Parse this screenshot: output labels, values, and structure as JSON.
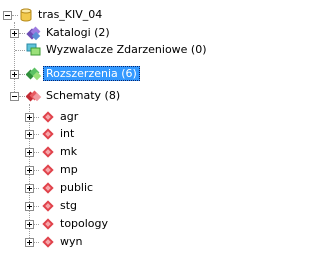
{
  "tree": {
    "root": {
      "label": "tras_KIV_04",
      "icon": "database-icon",
      "expanded": true
    },
    "children": [
      {
        "label": "Katalogi (2)",
        "icon": "catalog-icon",
        "expanded": false,
        "selected": false
      },
      {
        "label": "Wyzwalacze Zdarzeniowe (0)",
        "icon": "event-trigger-icon",
        "expanded": null,
        "selected": false
      },
      {
        "label": "Rozszerzenia (6)",
        "icon": "extension-icon",
        "expanded": false,
        "selected": true
      },
      {
        "label": "Schematy (8)",
        "icon": "schemas-icon",
        "expanded": true,
        "selected": false
      }
    ],
    "schemas": [
      {
        "label": "agr",
        "icon": "schema-icon"
      },
      {
        "label": "int",
        "icon": "schema-icon"
      },
      {
        "label": "mk",
        "icon": "schema-icon"
      },
      {
        "label": "mp",
        "icon": "schema-icon"
      },
      {
        "label": "public",
        "icon": "schema-icon"
      },
      {
        "label": "stg",
        "icon": "schema-icon"
      },
      {
        "label": "topology",
        "icon": "schema-icon"
      },
      {
        "label": "wyn",
        "icon": "schema-icon"
      }
    ]
  },
  "colors": {
    "selection_background": "#3399ff",
    "selection_text": "#ffffff",
    "database_icon": "#f2c94c",
    "catalog_icon": "#8a5cc7",
    "extension_icon": "#3fae49",
    "schema_icon": "#e0424b",
    "tree_lines": "#a0a0a0"
  }
}
